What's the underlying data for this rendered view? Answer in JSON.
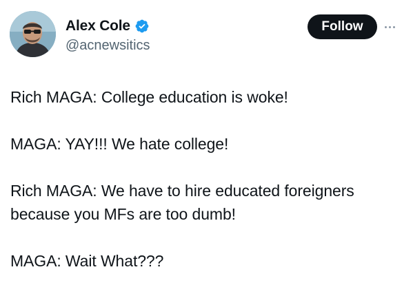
{
  "author": {
    "display_name": "Alex Cole",
    "handle": "@acnewsitics",
    "verified_icon": "verified-badge-icon",
    "avatar_icon": "avatar-photo"
  },
  "actions": {
    "follow_label": "Follow",
    "more_icon": "more-options-icon"
  },
  "tweet": {
    "paragraphs": [
      "Rich MAGA: College education is woke!",
      "MAGA: YAY!!! We hate college!",
      "Rich MAGA: We have to hire educated foreigners because you MFs are too dumb!",
      "MAGA: Wait What???"
    ]
  },
  "colors": {
    "text": "#0f1419",
    "secondary_text": "#536471",
    "verified_blue": "#1d9bf0",
    "follow_button_bg": "#0f1419",
    "follow_button_text": "#ffffff"
  }
}
